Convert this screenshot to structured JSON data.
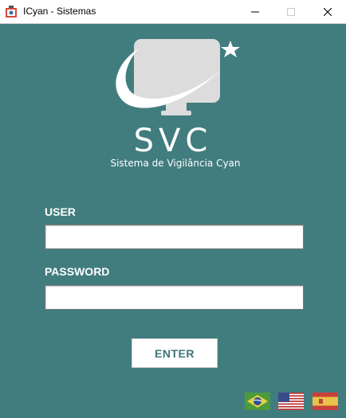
{
  "window": {
    "title": "ICyan - Sistemas",
    "controls": [
      "minimize",
      "maximize",
      "close"
    ]
  },
  "brand": {
    "name": "SVC",
    "subtitle": "Sistema de Vigilância Cyan",
    "logo_icon": "monitor-swoosh-star-icon"
  },
  "form": {
    "user_label": "USER",
    "user_value": "",
    "password_label": "PASSWORD",
    "password_value": "",
    "enter_label": "ENTER"
  },
  "languages": [
    {
      "flag": "brazil-flag-icon"
    },
    {
      "flag": "usa-flag-icon"
    },
    {
      "flag": "spain-flag-icon"
    }
  ],
  "colors": {
    "background": "#417d7e",
    "accent_text": "#3c7577",
    "logo": "#dcdcdc"
  }
}
